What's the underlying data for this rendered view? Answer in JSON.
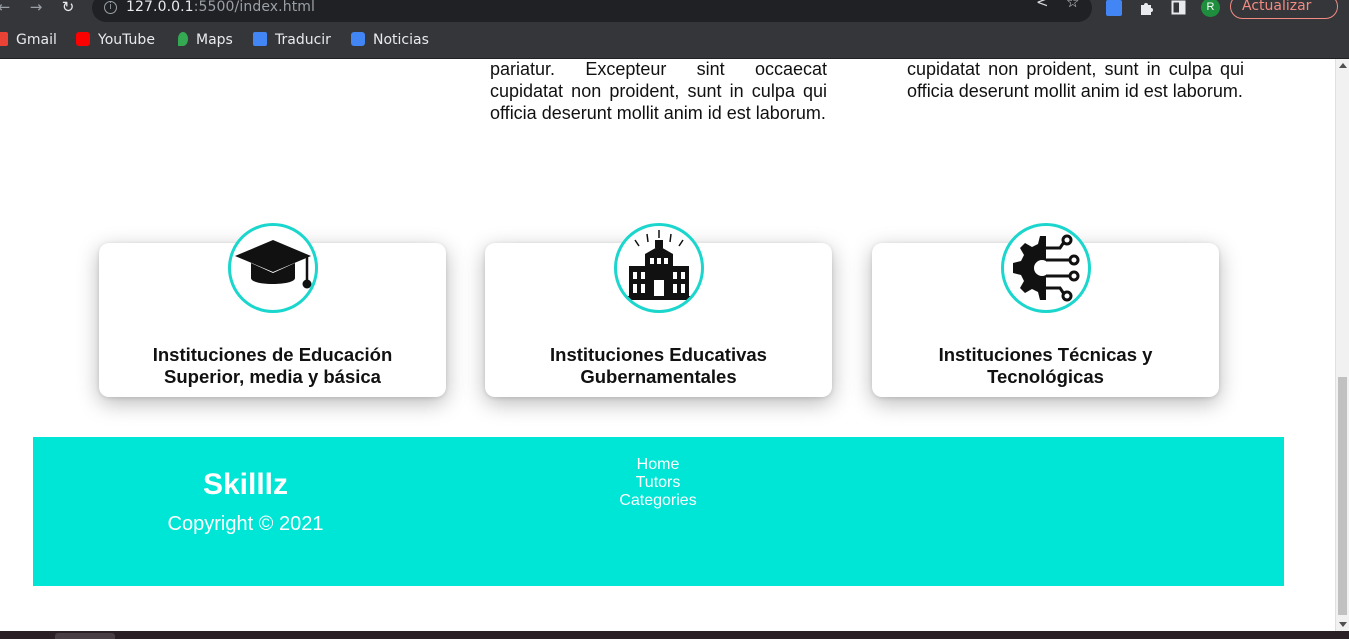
{
  "browser": {
    "url_host": "127.0.0.1",
    "url_rest": ":5500/index.html",
    "update_label": "Actualizar",
    "profile_initial": "R",
    "bookmarks": [
      {
        "label": "Gmail",
        "icon": "gmail-icon",
        "color": "#ea4335"
      },
      {
        "label": "YouTube",
        "icon": "youtube-icon",
        "color": "#ff0000"
      },
      {
        "label": "Maps",
        "icon": "maps-icon",
        "color": "#34a853"
      },
      {
        "label": "Traducir",
        "icon": "translate-icon",
        "color": "#4285f4"
      },
      {
        "label": "Noticias",
        "icon": "news-icon",
        "color": "#4285f4"
      }
    ]
  },
  "page": {
    "lorem_left": "pariatur. Excepteur sint occaecat cupidatat non proident, sunt in culpa qui officia deserunt mollit anim id est laborum.",
    "lorem_right": "cupidatat non proident, sunt in culpa qui officia deserunt mollit anim id est laborum.",
    "cards": [
      {
        "title": "Instituciones de Educación Superior, media y básica",
        "icon": "graduation-cap-icon"
      },
      {
        "title": "Instituciones Educativas Gubernamentales",
        "icon": "government-building-icon"
      },
      {
        "title": "Instituciones Técnicas y Tecnológicas",
        "icon": "tech-gear-circuit-icon"
      }
    ],
    "accent_color": "#00e6d6"
  },
  "footer": {
    "brand": "Skilllz",
    "copyright": "Copyright © 2021",
    "links": [
      "Home",
      "Tutors",
      "Categories"
    ]
  }
}
